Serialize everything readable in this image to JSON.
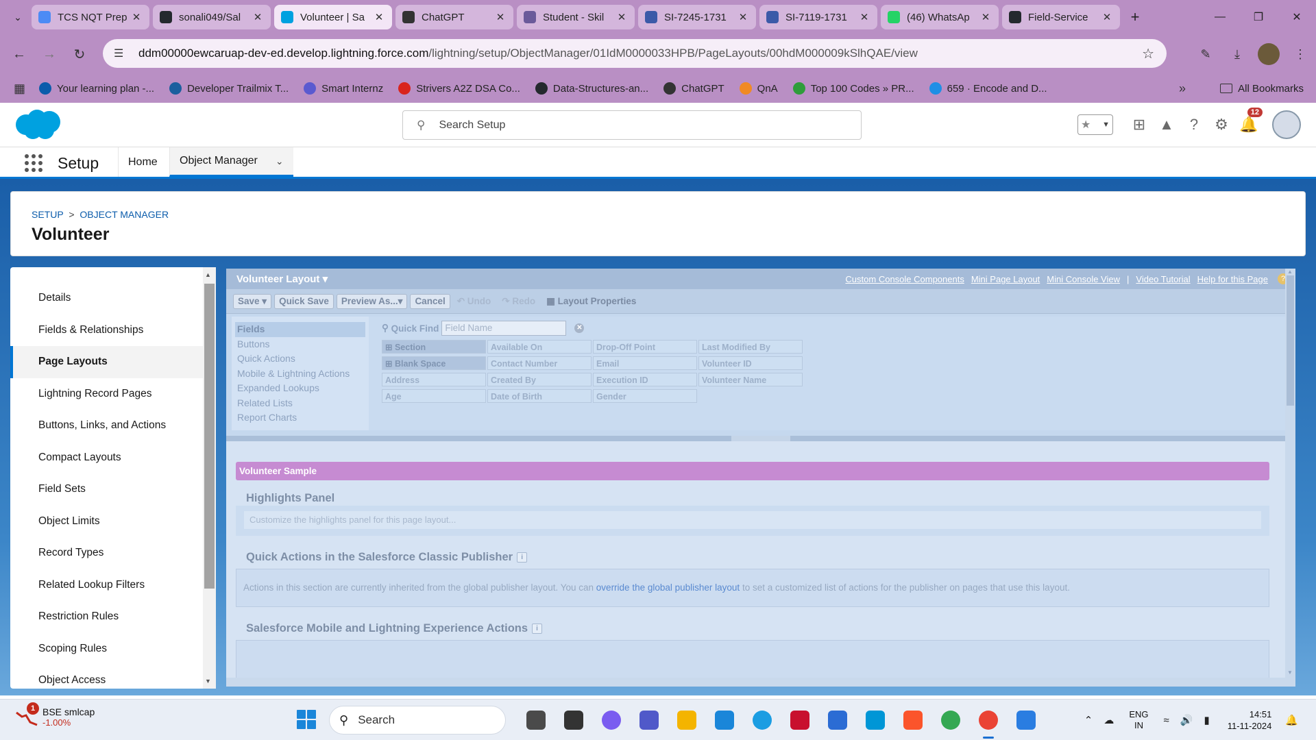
{
  "browser": {
    "tabs": [
      {
        "title": "TCS NQT Prep",
        "icon": "forms-icon",
        "color": "#4c8bf5",
        "active": false
      },
      {
        "title": "sonali049/Sal",
        "icon": "github-icon",
        "color": "#24292e",
        "active": false
      },
      {
        "title": "Volunteer | Sa",
        "icon": "salesforce-icon",
        "color": "#00a1e0",
        "active": true
      },
      {
        "title": "ChatGPT",
        "icon": "chatgpt-icon",
        "color": "#333333",
        "active": false
      },
      {
        "title": "Student - Skil",
        "icon": "skill-icon",
        "color": "#6a5a9a",
        "active": false
      },
      {
        "title": "SI-7245-1731",
        "icon": "doc-icon",
        "color": "#3b5aa8",
        "active": false
      },
      {
        "title": "SI-7119-1731",
        "icon": "doc-icon",
        "color": "#3b5aa8",
        "active": false
      },
      {
        "title": "(46) WhatsAp",
        "icon": "whatsapp-icon",
        "color": "#25d366",
        "active": false
      },
      {
        "title": "Field-Service",
        "icon": "github-icon",
        "color": "#24292e",
        "active": false
      }
    ],
    "url_host": "ddm00000ewcaruap-dev-ed.develop.lightning.force.com",
    "url_path": "/lightning/setup/ObjectManager/01IdM0000033HPB/PageLayouts/00hdM000009kSlhQAE/view",
    "bookmarks": [
      {
        "label": "Your learning plan -...",
        "icon": "trailhead-icon",
        "color": "#0b5cab"
      },
      {
        "label": "Developer Trailmix T...",
        "icon": "trailmix-icon",
        "color": "#1b5f9e"
      },
      {
        "label": "Smart Internz",
        "icon": "smartinternz-icon",
        "color": "#5a5ad0"
      },
      {
        "label": "Strivers A2Z DSA Co...",
        "icon": "tuf-icon",
        "color": "#d9251d"
      },
      {
        "label": "Data-Structures-an...",
        "icon": "github-icon",
        "color": "#24292e"
      },
      {
        "label": "ChatGPT",
        "icon": "chatgpt-icon",
        "color": "#333333"
      },
      {
        "label": "QnA",
        "icon": "qna-icon",
        "color": "#f08a24"
      },
      {
        "label": "Top 100 Codes » PR...",
        "icon": "prepinsta-icon",
        "color": "#2e9d3a"
      },
      {
        "label": "659 · Encode and D...",
        "icon": "leetcode-icon",
        "color": "#1f8fe5"
      }
    ],
    "all_bookmarks": "All Bookmarks"
  },
  "sf": {
    "search_placeholder": "Search Setup",
    "notification_count": "12",
    "app_name": "Setup",
    "nav_home": "Home",
    "nav_object_manager": "Object Manager",
    "breadcrumb_setup": "SETUP",
    "breadcrumb_sep": ">",
    "breadcrumb_om": "OBJECT MANAGER",
    "object_title": "Volunteer",
    "left_nav": [
      "Details",
      "Fields & Relationships",
      "Page Layouts",
      "Lightning Record Pages",
      "Buttons, Links, and Actions",
      "Compact Layouts",
      "Field Sets",
      "Object Limits",
      "Record Types",
      "Related Lookup Filters",
      "Restriction Rules",
      "Scoping Rules",
      "Object Access"
    ],
    "left_nav_active": "Page Layouts"
  },
  "editor": {
    "layout_name": "Volunteer Layout",
    "header_links": [
      "Custom Console Components",
      "Mini Page Layout",
      "Mini Console View",
      "Video Tutorial",
      "Help for this Page"
    ],
    "toolbar": {
      "save": "Save",
      "quick_save": "Quick Save",
      "preview_as": "Preview As...",
      "cancel": "Cancel",
      "undo": "Undo",
      "redo": "Redo",
      "layout_properties": "Layout Properties"
    },
    "palette_categories": [
      "Fields",
      "Buttons",
      "Quick Actions",
      "Mobile & Lightning Actions",
      "Expanded Lookups",
      "Related Lists",
      "Report Charts"
    ],
    "quick_find_label": "Quick Find",
    "quick_find_placeholder": "Field Name",
    "palette_fields": [
      "Section",
      "Available On",
      "Drop-Off Point",
      "Last Modified By",
      "Blank Space",
      "Contact Number",
      "Email",
      "Volunteer ID",
      "Address",
      "Created By",
      "Execution ID",
      "Volunteer Name",
      "Age",
      "Date of Birth",
      "Gender"
    ],
    "sample_bar": "Volunteer Sample",
    "highlights_heading": "Highlights Panel",
    "highlights_placeholder": "Customize the highlights panel for this page layout...",
    "quick_actions_heading": "Quick Actions in the Salesforce Classic Publisher",
    "quick_actions_text_before": "Actions in this section are currently inherited from the global publisher layout. You can ",
    "quick_actions_link": "override the global publisher layout",
    "quick_actions_text_after": " to set a customized list of actions for the publisher on pages that use this layout.",
    "mobile_heading": "Salesforce Mobile and Lightning Experience Actions"
  },
  "taskbar": {
    "widget_name": "BSE smlcap",
    "widget_value": "-1.00%",
    "widget_badge": "1",
    "search_placeholder": "Search",
    "apps": [
      {
        "icon": "graduation-cap-icon",
        "color": "#4a4a4a"
      },
      {
        "icon": "task-view-icon",
        "color": "#333333"
      },
      {
        "icon": "copilot-icon",
        "color": "#7a5cf0"
      },
      {
        "icon": "teams-icon",
        "color": "#5059c9"
      },
      {
        "icon": "file-explorer-icon",
        "color": "#f4b400"
      },
      {
        "icon": "get-help-icon",
        "color": "#1a86d9"
      },
      {
        "icon": "edge-icon",
        "color": "#1b9de2"
      },
      {
        "icon": "mcafee-icon",
        "color": "#c8102e"
      },
      {
        "icon": "ms-store-icon",
        "color": "#2b6cd4"
      },
      {
        "icon": "myhp-icon",
        "color": "#0096d6"
      },
      {
        "icon": "brave-icon",
        "color": "#fb542b"
      },
      {
        "icon": "chrome-icon",
        "color": "#34a853"
      },
      {
        "icon": "chrome-profile-icon",
        "color": "#ea4335"
      },
      {
        "icon": "photos-icon",
        "color": "#2a7de1"
      }
    ],
    "lang_line1": "ENG",
    "lang_line2": "IN",
    "time": "14:51",
    "date": "11-11-2024"
  }
}
